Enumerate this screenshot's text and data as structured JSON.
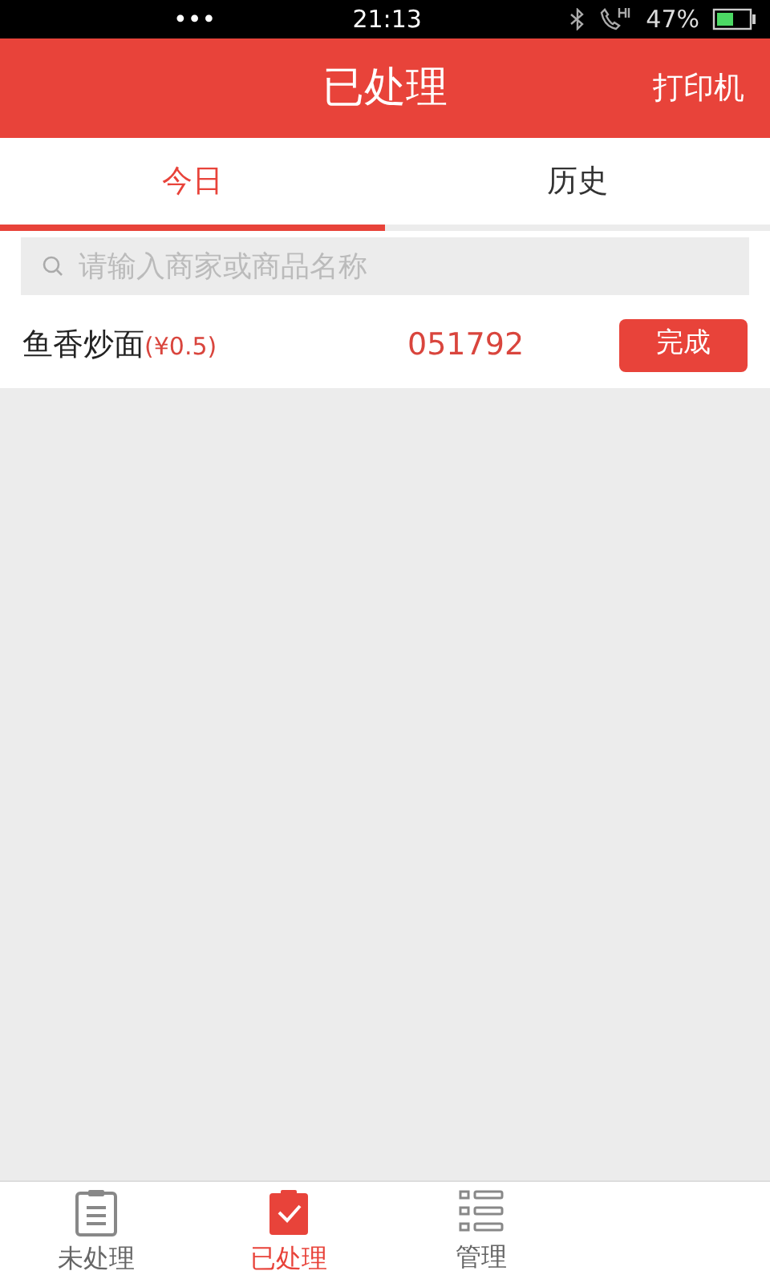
{
  "status_bar": {
    "carrier": "•••",
    "time": "21:13",
    "battery": "47%"
  },
  "header": {
    "title": "已处理",
    "action": "打印机"
  },
  "tabs": [
    {
      "label": "今日",
      "selected": true
    },
    {
      "label": "历史",
      "selected": false
    }
  ],
  "search": {
    "placeholder": "请输入商家或商品名称"
  },
  "orders": [
    {
      "name": "鱼香炒面",
      "price": "(¥0.5)",
      "code": "051792",
      "button": "完成"
    }
  ],
  "bottom_nav": [
    {
      "label": "未处理",
      "kind": "pending",
      "selected": false
    },
    {
      "label": "已处理",
      "kind": "done",
      "selected": true
    },
    {
      "label": "管理",
      "kind": "manage",
      "selected": false
    }
  ]
}
